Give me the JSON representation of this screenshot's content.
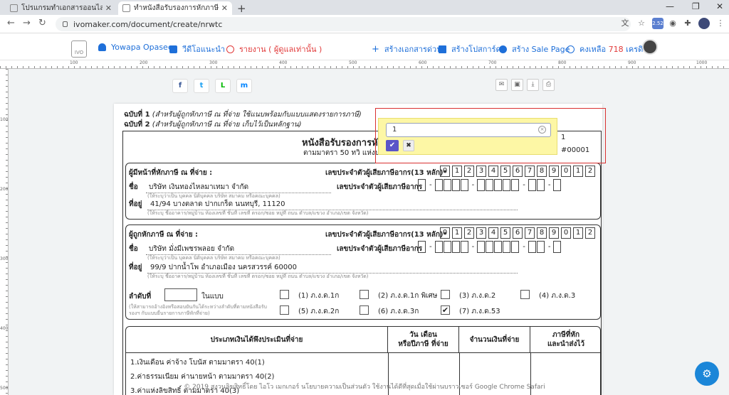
{
  "browser": {
    "tabs": [
      {
        "label": "โปรแกรมทำเอกสารออนไลน์ | โปรแกรม",
        "active": false
      },
      {
        "label": "ทำหนังสือรับรองการหักภาษี ณ ที่จ่าย (",
        "active": true
      }
    ],
    "url": "ivomaker.com/document/create/nrwtc",
    "ext_badge": "2.52"
  },
  "header": {
    "logo_text": "IVO",
    "user_name": "Yowapa Opasee",
    "video_link": "วีดีโอแนะนำ",
    "report_link": "รายงาน ( ผู้ดูแลเท่านั้น )",
    "create_quick": "สร้างเอกสารด่วน",
    "create_poster": "สร้างโปสการ์ด",
    "create_salepage": "สร้าง Sale Page",
    "credit_prefix": "คงเหลือ",
    "credit_value": "718",
    "credit_suffix": "เครดิต"
  },
  "ruler_numbers": [
    "100",
    "200",
    "300",
    "400",
    "500",
    "600",
    "700",
    "800",
    "900",
    "1000"
  ],
  "vruler_numbers": [
    "100",
    "200",
    "300",
    "400",
    "500"
  ],
  "share": [
    "f",
    "t",
    "L",
    "m"
  ],
  "actions": [
    "✉",
    "▣",
    "⤓",
    "⎙"
  ],
  "document": {
    "copy1_label": "ฉบับที่ 1",
    "copy1_desc": "(สำหรับผู้ถูกหักภาษี ณ ที่จ่าย ใช้แนบพร้อมกับแบบแสดงรายการภาษี)",
    "copy2_label": "ฉบับที่ 2",
    "copy2_desc": "(สำหรับผู้ถูกหักภาษี ณ ที่จ่าย เก็บไว้เป็นหลักฐาน)",
    "title": "หนังสือรับรองการหัก",
    "subtitle": "ตามมาตรา 50 ทวิ แห่งป",
    "book_no": "1",
    "doc_no": "#00001",
    "payer": {
      "section_label": "ผู้มีหน้าที่หักภาษี ณ ที่จ่าย :",
      "taxid_label": "เลขประจำตัวผู้เสียภาษีอากร(13 หลัก)*",
      "taxid_digits": [
        "0",
        "1",
        "2",
        "3",
        "4",
        "5",
        "6",
        "7",
        "8",
        "9",
        "0",
        "1",
        "2"
      ],
      "name_label": "ชื่อ",
      "name_value": "บริษัท เงินทองไหลมาเทมา จำกัด",
      "name_hint": "(ให้ระบุว่าเป็น บุคคล นิติบุคคล บริษัท สมาคม หรือคณะบุคคล)",
      "taxid2_label": "เลขประจำตัวผู้เสียภาษีอากร",
      "address_label": "ที่อยู่",
      "address_value": "41/94 บางตลาด ปากเกร็ด นนทบุรี, 11120",
      "address_hint": "(ให้ระบุ ชื่ออาคาร/หมู่บ้าน ห้องเลขที่ ชั้นที่ เลขที่ ตรอก/ซอย หมู่ที่ ถนน ตำบล/แขวง อำเภอ/เขต จังหวัด)"
    },
    "payee": {
      "section_label": "ผู้ถูกหักภาษี ณ ที่จ่าย :",
      "taxid_label": "เลขประจำตัวผู้เสียภาษีอากร(13 หลัก)*",
      "taxid_digits": [
        "0",
        "1",
        "2",
        "3",
        "4",
        "5",
        "6",
        "7",
        "8",
        "9",
        "0",
        "1",
        "2"
      ],
      "name_label": "ชื่อ",
      "name_value": "บริษัท มั่งมีเพชรพลอย จำกัด",
      "name_hint": "(ให้ระบุว่าเป็น บุคคล นิติบุคคล บริษัท สมาคม หรือคณะบุคคล)",
      "taxid2_label": "เลขประจำตัวผู้เสียภาษีอากร",
      "address_label": "ที่อยู่",
      "address_value": "99/9 ปากน้ำโพ อำเภอเมือง นครสวรรค์ 60000",
      "address_hint": "(ให้ระบุ ชื่ออาคาร/หมู่บ้าน ห้องเลขที่ ชั้นที่ เลขที่ ตรอก/ซอย หมู่ที่ ถนน ตำบล/แขวง อำเภอ/เขต จังหวัด)"
    },
    "order_label": "ลำดับที่",
    "order_suffix": "ในแบบ",
    "order_hint_1": "(ให้สามารถอ้างอิงหรือสอบยันกันได้ระหว่างลำดับที่ตามหนังสือรับ",
    "order_hint_2": "รองฯ กับแบบยื่นรายการภาษีหักที่จ่าย)",
    "forms": [
      {
        "label": "(1) ภ.ง.ด.1ก",
        "checked": false
      },
      {
        "label": "(2) ภ.ง.ด.1ก พิเศษ",
        "checked": false
      },
      {
        "label": "(3) ภ.ง.ด.2",
        "checked": false
      },
      {
        "label": "(4) ภ.ง.ด.3",
        "checked": false
      },
      {
        "label": "(5) ภ.ง.ด.2ก",
        "checked": false
      },
      {
        "label": "(6) ภ.ง.ด.3ก",
        "checked": false
      },
      {
        "label": "(7) ภ.ง.ด.53",
        "checked": true
      }
    ],
    "table": {
      "headers": [
        "ประเภทเงินได้พึงประเมินที่จ่าย",
        "วัน เดือน\nหรือปีภาษี ที่จ่าย",
        "จำนวนเงินที่จ่าย",
        "ภาษีที่หัก\nและนำส่งไว้"
      ],
      "rows": [
        "1.เงินเดือน ค่าจ้าง โบนัส ตามมาตรา 40(1)",
        "2.ค่าธรรมเนียม ค่านายหน้า ตามมาตรา 40(2)",
        "3.ค่าแห่งลิขสิทธิ์ ตามมาตรา 40(3)"
      ]
    }
  },
  "popup": {
    "input_value": "1",
    "confirm_glyph": "✔",
    "cancel_glyph": "✖",
    "clear_glyph": "×"
  },
  "footer": "© 2019 สงวนลิขสิทธิ์โดย ไอโว เมกเกอร์ นโยบายความเป็นส่วนตัว ใช้งานได้ดีที่สุดเมื่อใช้ผ่านบราวเซอร์ Google Chrome Safari",
  "colors": {
    "accent": "#1e6fd9",
    "danger": "#e13a3a",
    "popup_bg": "#fdf7a5",
    "confirm": "#5a55c8",
    "fab": "#1b86d8"
  }
}
